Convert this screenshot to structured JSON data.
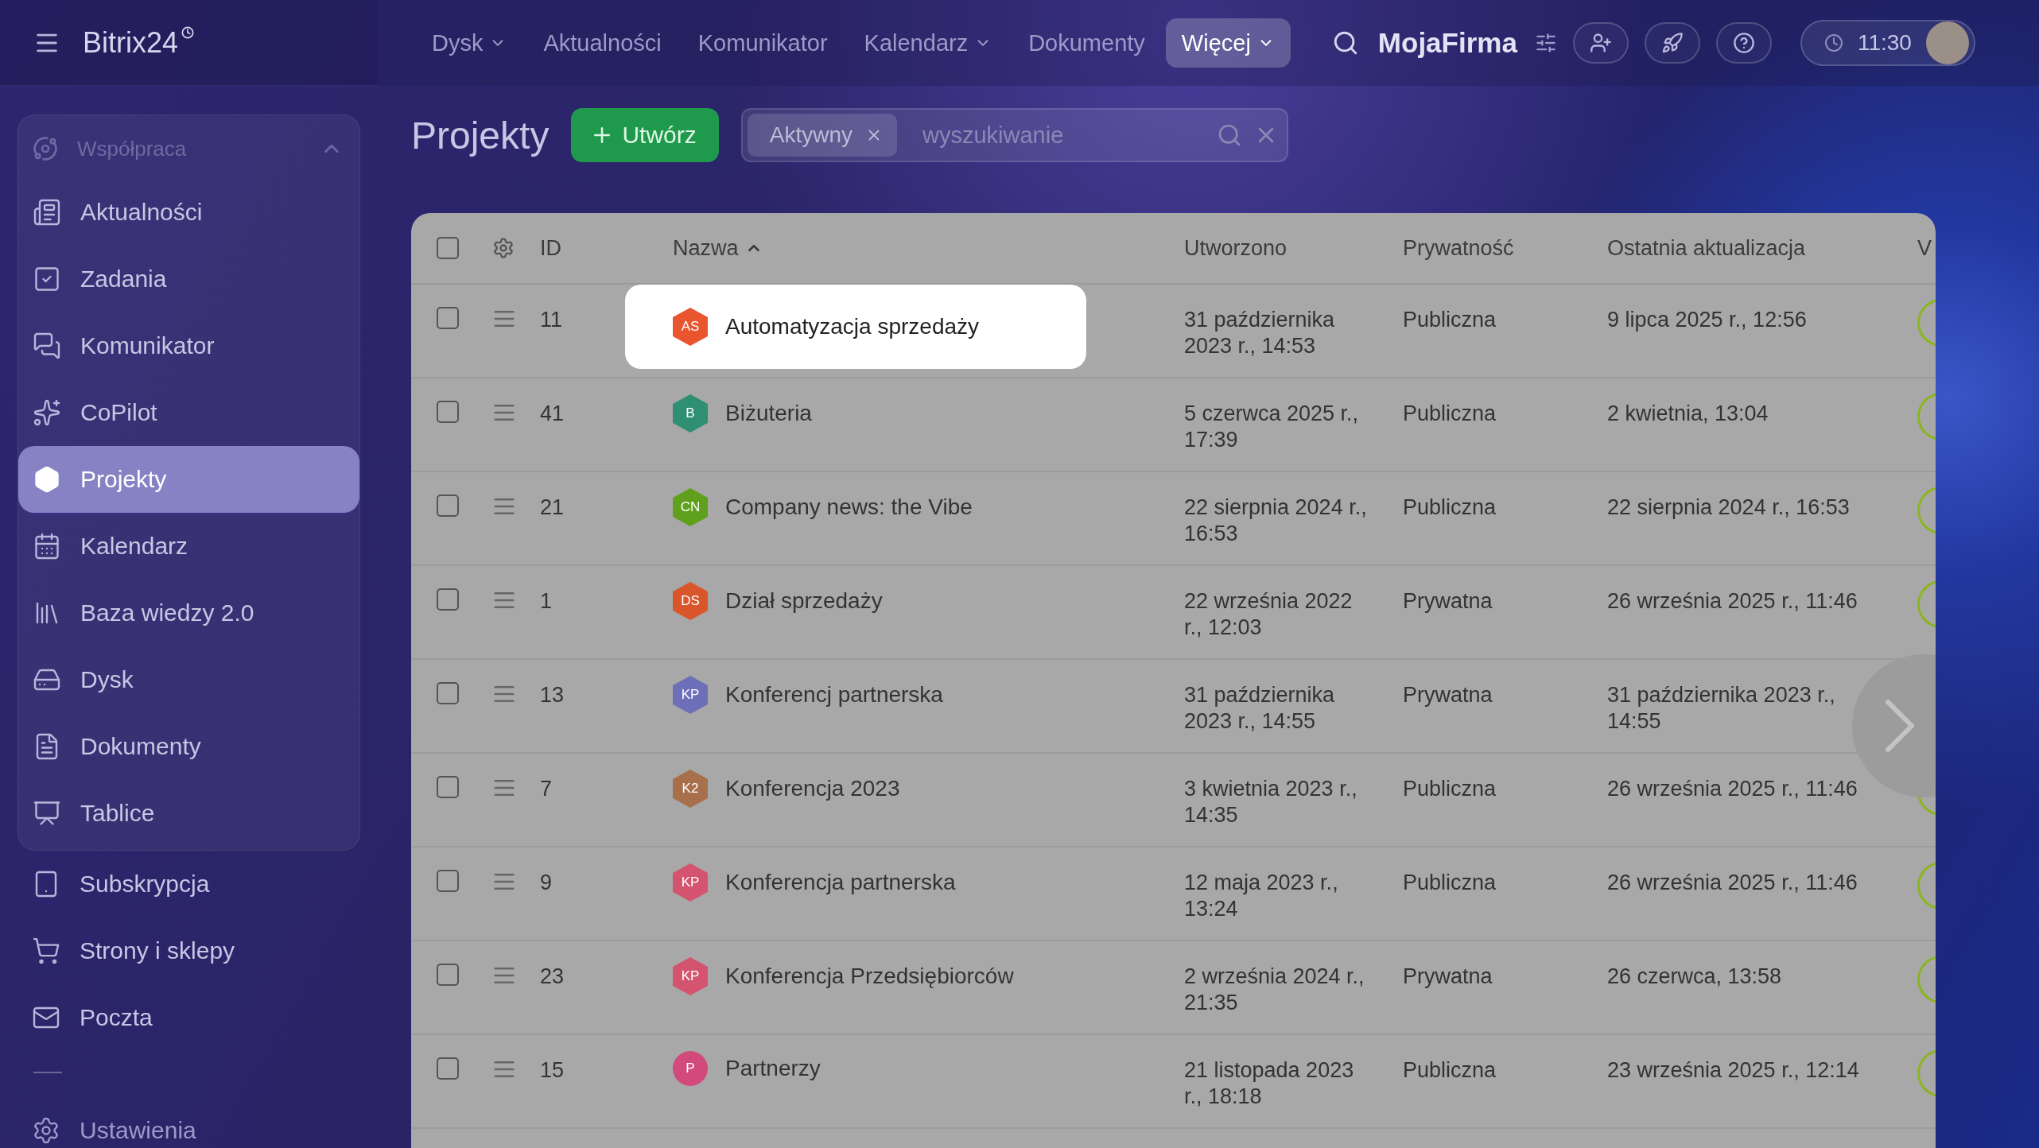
{
  "topbar": {
    "logo": "Bitrix24",
    "menu": [
      {
        "label": "Dysk",
        "dropdown": true,
        "selected": false
      },
      {
        "label": "Aktualności",
        "dropdown": false,
        "selected": false
      },
      {
        "label": "Komunikator",
        "dropdown": false,
        "selected": false
      },
      {
        "label": "Kalendarz",
        "dropdown": true,
        "selected": false
      },
      {
        "label": "Dokumenty",
        "dropdown": false,
        "selected": false
      },
      {
        "label": "Więcej",
        "dropdown": true,
        "selected": true
      }
    ],
    "company": "MojaFirma",
    "time": "11:30"
  },
  "sidebar": {
    "group": {
      "title": "Współpraca",
      "expanded": true,
      "items": [
        {
          "label": "Aktualności",
          "selected": false
        },
        {
          "label": "Zadania",
          "selected": false
        },
        {
          "label": "Komunikator",
          "selected": false
        },
        {
          "label": "CoPilot",
          "selected": false
        },
        {
          "label": "Projekty",
          "selected": true
        },
        {
          "label": "Kalendarz",
          "selected": false
        },
        {
          "label": "Baza wiedzy 2.0",
          "selected": false
        },
        {
          "label": "Dysk",
          "selected": false
        },
        {
          "label": "Dokumenty",
          "selected": false
        },
        {
          "label": "Tablice",
          "selected": false
        }
      ]
    },
    "items": [
      {
        "label": "Subskrypcja",
        "selected": false
      },
      {
        "label": "Strony i sklepy",
        "selected": false
      },
      {
        "label": "Poczta",
        "selected": false
      }
    ],
    "settings": "Ustawienia"
  },
  "page": {
    "title": "Projekty",
    "create_button": "Utwórz",
    "filter": {
      "chip": "Aktywny",
      "placeholder": "wyszukiwanie"
    }
  },
  "table": {
    "select_all_checked": false,
    "columns": [
      {
        "label": "ID",
        "sorted": false
      },
      {
        "label": "Nazwa",
        "sorted": true
      },
      {
        "label": "Utworzono",
        "sorted": false
      },
      {
        "label": "Prywatność",
        "sorted": false
      },
      {
        "label": "Ostatnia aktualizacja",
        "sorted": false
      },
      {
        "label": "V",
        "sorted": false
      }
    ],
    "rows": [
      {
        "id": "11",
        "initials": "AS",
        "kind": "hexagon",
        "color": "#e8552f",
        "name": "Automatyzacja sprzedaży",
        "created": "31 października 2023 r., 14:53",
        "privacy": "Publiczna",
        "updated": "9 lipca 2025 r., 12:56",
        "checked": false,
        "highlighted": true
      },
      {
        "id": "41",
        "initials": "B",
        "kind": "hexagon",
        "color": "#2f8f72",
        "name": "Biżuteria",
        "created": "5 czerwca 2025 r., 17:39",
        "privacy": "Publiczna",
        "updated": "2 kwietnia, 13:04",
        "checked": false,
        "highlighted": false
      },
      {
        "id": "21",
        "initials": "CN",
        "kind": "hexagon",
        "color": "#5fa01c",
        "name": "Company news: the Vibe",
        "created": "22 sierpnia 2024 r., 16:53",
        "privacy": "Publiczna",
        "updated": "22 sierpnia 2024 r., 16:53",
        "checked": false,
        "highlighted": false
      },
      {
        "id": "1",
        "initials": "DS",
        "kind": "hexagon",
        "color": "#d9562a",
        "name": "Dział sprzedaży",
        "created": "22 września 2022 r., 12:03",
        "privacy": "Prywatna",
        "updated": "26 września 2025 r., 11:46",
        "checked": false,
        "highlighted": false
      },
      {
        "id": "13",
        "initials": "KP",
        "kind": "hexagon",
        "color": "#6d6fb8",
        "name": "Konferencj partnerska",
        "created": "31 października 2023 r., 14:55",
        "privacy": "Prywatna",
        "updated": "31 października 2023 r., 14:55",
        "checked": false,
        "highlighted": false
      },
      {
        "id": "7",
        "initials": "K2",
        "kind": "hexagon",
        "color": "#a8704a",
        "name": "Konferencja 2023",
        "created": "3 kwietnia 2023 r., 14:35",
        "privacy": "Publiczna",
        "updated": "26 września 2025 r., 11:46",
        "checked": false,
        "highlighted": false
      },
      {
        "id": "9",
        "initials": "KP",
        "kind": "hexagon",
        "color": "#d45470",
        "name": "Konferencja partnerska",
        "created": "12 maja 2023 r., 13:24",
        "privacy": "Publiczna",
        "updated": "26 września 2025 r., 11:46",
        "checked": false,
        "highlighted": false
      },
      {
        "id": "23",
        "initials": "KP",
        "kind": "hexagon",
        "color": "#d45470",
        "name": "Konferencja Przedsiębiorców",
        "created": "2 września 2024 r., 21:35",
        "privacy": "Prywatna",
        "updated": "26 czerwca, 13:58",
        "checked": false,
        "highlighted": false
      },
      {
        "id": "15",
        "initials": "P",
        "kind": "circle",
        "color": "#d24a7c",
        "name": "Partnerzy",
        "created": "21 listopada 2023 r., 18:18",
        "privacy": "Publiczna",
        "updated": "23 września 2025 r., 12:14",
        "checked": false,
        "highlighted": false
      }
    ]
  }
}
